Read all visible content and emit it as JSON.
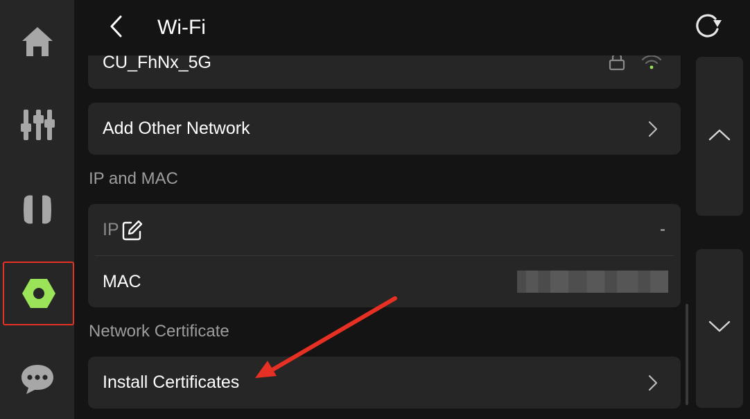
{
  "header": {
    "title": "Wi-Fi"
  },
  "sidebar": {
    "items": [
      {
        "name": "home",
        "icon": "home-icon",
        "active": false
      },
      {
        "name": "controls",
        "icon": "sliders-icon",
        "active": false
      },
      {
        "name": "media",
        "icon": "media-icon",
        "active": false
      },
      {
        "name": "settings",
        "icon": "hex-nut-icon",
        "active": true
      },
      {
        "name": "messages",
        "icon": "chat-bubble-icon",
        "active": false
      }
    ]
  },
  "networks": {
    "current": {
      "ssid": "CU_FhNx_5G",
      "secured": true,
      "connected": true
    },
    "add_other_label": "Add Other Network"
  },
  "ip_mac": {
    "section_title": "IP and MAC",
    "ip_label": "IP",
    "ip_value": "-",
    "mac_label": "MAC"
  },
  "certificate": {
    "section_title": "Network Certificate",
    "install_label": "Install Certificates"
  },
  "colors": {
    "accent": "#9be45a",
    "annotation": "#e53023",
    "card": "#262626",
    "background": "#141414"
  }
}
